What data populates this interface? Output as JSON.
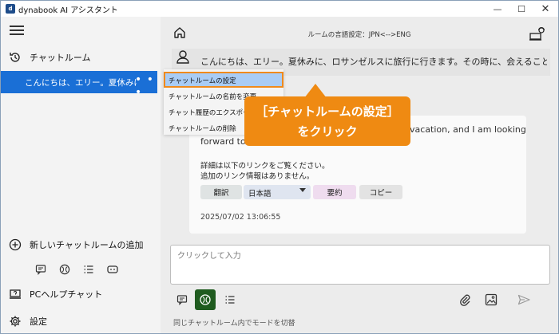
{
  "window": {
    "logo_text": "d",
    "title": "dynabook AI アシスタント",
    "minimize": "—",
    "maximize": "☐",
    "close": "✕"
  },
  "sidebar": {
    "chatroom_header": "チャットルーム",
    "selected_room": "こんにちは、エリー。夏休みに、ロサンゼルスに旅行に行きます。",
    "more": "• • •",
    "add_room": "新しいチャットルームの追加",
    "pc_help": "PCヘルプチャット",
    "settings": "設定"
  },
  "main": {
    "language_setting": "ルームの言語設定：JPN<-->ENG",
    "user_message": "こんにちは、エリー。夏休みに、ロサンゼルスに旅行に行きます。その時に、会えることを楽しみにして",
    "bot_en_line1": "vacation, and I am looking",
    "bot_en_line2": "forward to se",
    "bot_detail_line1": "詳細は以下のリンクをご覧ください。",
    "bot_detail_line2": "追加のリンク情報はありません。",
    "translate_button": "翻訳",
    "language_select": "日本語",
    "summary_button": "要約",
    "copy_button": "コピー",
    "timestamp": "2025/07/02 13:06:55",
    "input_placeholder": "クリックして入力",
    "mode_caption": "同じチャットルーム内でモードを切替"
  },
  "context_menu": {
    "items": [
      "チャットルームの設定",
      "チャットルームの名前を変更",
      "チャット履歴のエクスポート",
      "チャットルームの削除"
    ]
  },
  "callout": {
    "line1": "［チャットルームの設定］",
    "line2": "をクリック"
  },
  "colors": {
    "selected_room": "#1a6fd6",
    "callout": "#ef8a12",
    "active_mode": "#1f5b1f"
  }
}
